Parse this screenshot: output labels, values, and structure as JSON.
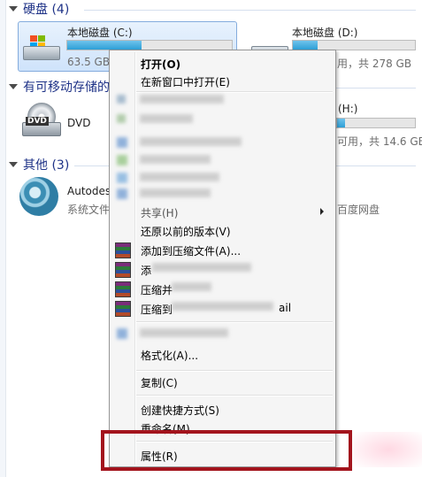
{
  "sections": {
    "hdd": {
      "title": "硬盘 (4)"
    },
    "removable": {
      "title": "有可移动存储的"
    },
    "other": {
      "title": "其他 (3)"
    }
  },
  "drives": {
    "c": {
      "name": "本地磁盘 (C:)",
      "free": "63.5 GB",
      "fill": 0.45
    },
    "d": {
      "name": "本地磁盘 (D:)",
      "free_total": "用，共 278 GB",
      "fill": 0.2
    },
    "dvd": {
      "name": "DVD"
    },
    "h": {
      "label": "(H:)",
      "free_total": "可用，共 14.6 GB",
      "fill": 0.1
    },
    "autodesk": {
      "name": "Autodes",
      "sub": "系统文件",
      "right_sub": "百度网盘"
    }
  },
  "context_menu": {
    "items": [
      {
        "label": "打开(O)",
        "bold": true
      },
      {
        "label": "在新窗口中打开(E)"
      },
      {
        "label": "共享(H)",
        "submenu": true
      },
      {
        "label": "还原以前的版本(V)"
      },
      {
        "label": "添加到压缩文件(A)..."
      },
      {
        "label": "添"
      },
      {
        "label": "压缩并"
      },
      {
        "label": "压缩到"
      },
      {
        "label": "ail"
      },
      {
        "label": "格式化(A)..."
      },
      {
        "label": "复制(C)"
      },
      {
        "label": "创建快捷方式(S)"
      },
      {
        "label": "重命名(M)"
      },
      {
        "label": "属性(R)"
      }
    ]
  },
  "colors": {
    "accent_red": "#a3141d",
    "section_blue": "#1e3287",
    "capacity_fill": "#2d9fd6"
  },
  "icons": [
    "hdd-icon",
    "dvd-icon",
    "autodesk-icon",
    "winrar-icon",
    "submenu-arrow-icon"
  ]
}
